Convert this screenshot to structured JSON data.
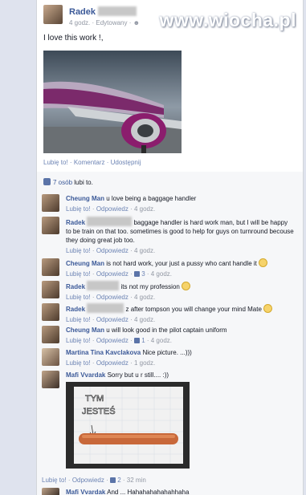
{
  "watermark": "www.wiocha.pl",
  "post": {
    "author": "Radek",
    "time": "4 godz.",
    "edited": "Edytowany",
    "text": "I love this work !,"
  },
  "actions": {
    "like": "Lubię to!",
    "comment": "Komentarz",
    "share": "Udostępnij"
  },
  "likes": {
    "count": "7 osób",
    "suffix": "lubi to."
  },
  "comments": [
    {
      "name": "Cheung Man",
      "text": "u love being a baggage handler",
      "like": "Lubię to!",
      "reply": "Odpowiedz",
      "likes": "",
      "time": "4 godz."
    },
    {
      "name": "Radek",
      "text": "baggage handler is hard work man, but I will be happy to be train on that too. sometimes is good to help for guys on turnround becouse they doing great job too.",
      "like": "Lubię to!",
      "reply": "Odpowiedz",
      "likes": "",
      "time": "4 godz."
    },
    {
      "name": "Cheung Man",
      "text": "is not hard work, your just a pussy who cant handle it",
      "like": "Lubię to!",
      "reply": "Odpowiedz",
      "likes": "3",
      "time": "4 godz."
    },
    {
      "name": "Radek",
      "text": "its not my profession",
      "like": "Lubię to!",
      "reply": "Odpowiedz",
      "likes": "",
      "time": "4 godz."
    },
    {
      "name": "Radek",
      "text": "z after tompson you will change your mind Mate",
      "like": "Lubię to!",
      "reply": "Odpowiedz",
      "likes": "",
      "time": "4 godz."
    },
    {
      "name": "Cheung Man",
      "text": "u will look good in the pilot captain uniform",
      "like": "Lubię to!",
      "reply": "Odpowiedz",
      "likes": "1",
      "time": "4 godz."
    },
    {
      "name": "Martina Tina Kavclakova",
      "text": "Nice picture. ...)))",
      "like": "Lubię to!",
      "reply": "Odpowiedz",
      "likes": "",
      "time": "1 godz."
    },
    {
      "name": "Mafi Vvardak",
      "text": "Sorry but u r still.... :))",
      "like": "Lubię to!",
      "reply": "Odpowiedz",
      "likes": "2",
      "time": "32 min"
    },
    {
      "name": "Mafi Vvardak",
      "text": "And ... Hahahahahahahhaha"
    }
  ],
  "photo_note": {
    "line1": "TYM",
    "line2": "JESTEŚ"
  }
}
